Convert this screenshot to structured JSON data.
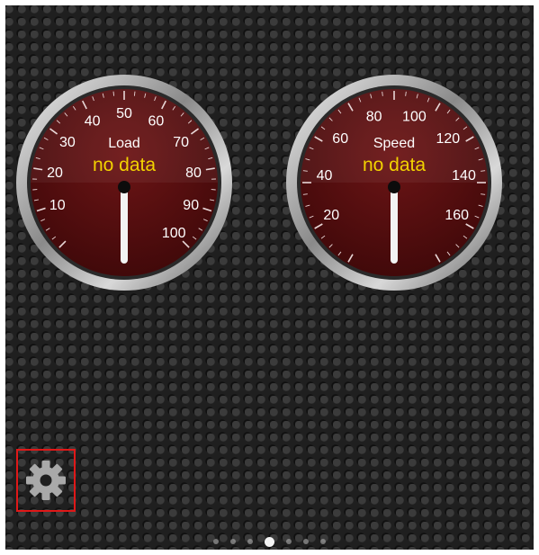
{
  "gauges": [
    {
      "title": "Load",
      "value_text": "no data",
      "ticks": [
        "10",
        "20",
        "30",
        "40",
        "50",
        "60",
        "70",
        "80",
        "90",
        "100"
      ],
      "min": 0,
      "max": 100
    },
    {
      "title": "Speed",
      "value_text": "no data",
      "ticks": [
        "20",
        "40",
        "60",
        "80",
        "100",
        "120",
        "140",
        "160"
      ],
      "min": 0,
      "max": 180
    }
  ],
  "settings": {
    "icon": "gear-icon"
  },
  "pager": {
    "count": 7,
    "active_index": 3
  },
  "colors": {
    "dial_face": "#5a0f10",
    "dial_text": "#ffffff",
    "value_text": "#f2d200",
    "highlight": "#e01818"
  }
}
